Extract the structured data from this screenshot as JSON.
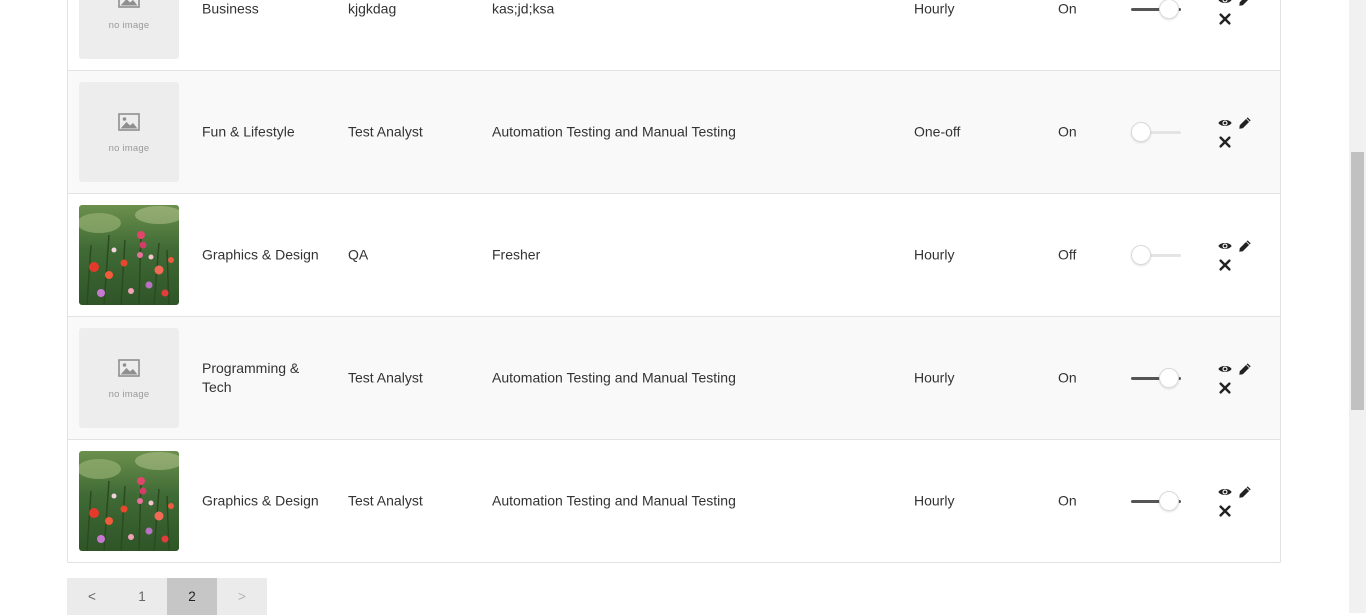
{
  "placeholder": {
    "text": "no image"
  },
  "rows": [
    {
      "category": "Business",
      "title": "kjgkdag",
      "description": "kas;jd;ksa",
      "type": "Hourly",
      "status": "On",
      "toggle_on": true,
      "image": "none"
    },
    {
      "category": "Fun & Lifestyle",
      "title": "Test Analyst",
      "description": "Automation Testing and Manual Testing",
      "type": "One-off",
      "status": "On",
      "toggle_on": false,
      "image": "none"
    },
    {
      "category": "Graphics & Design",
      "title": "QA",
      "description": "Fresher",
      "type": "Hourly",
      "status": "Off",
      "toggle_on": false,
      "image": "flowers-photo"
    },
    {
      "category": "Programming & Tech",
      "title": "Test Analyst",
      "description": "Automation Testing and Manual Testing",
      "type": "Hourly",
      "status": "On",
      "toggle_on": true,
      "image": "none"
    },
    {
      "category": "Graphics & Design",
      "title": "Test Analyst",
      "description": "Automation Testing and Manual Testing",
      "type": "Hourly",
      "status": "On",
      "toggle_on": true,
      "image": "flowers-photo"
    }
  ],
  "actions": {
    "view": "eye-icon",
    "edit": "pencil-icon",
    "delete": "close-icon"
  },
  "pagination": {
    "prev": "<",
    "pages": [
      "1",
      "2"
    ],
    "current": "2",
    "next": ">"
  }
}
